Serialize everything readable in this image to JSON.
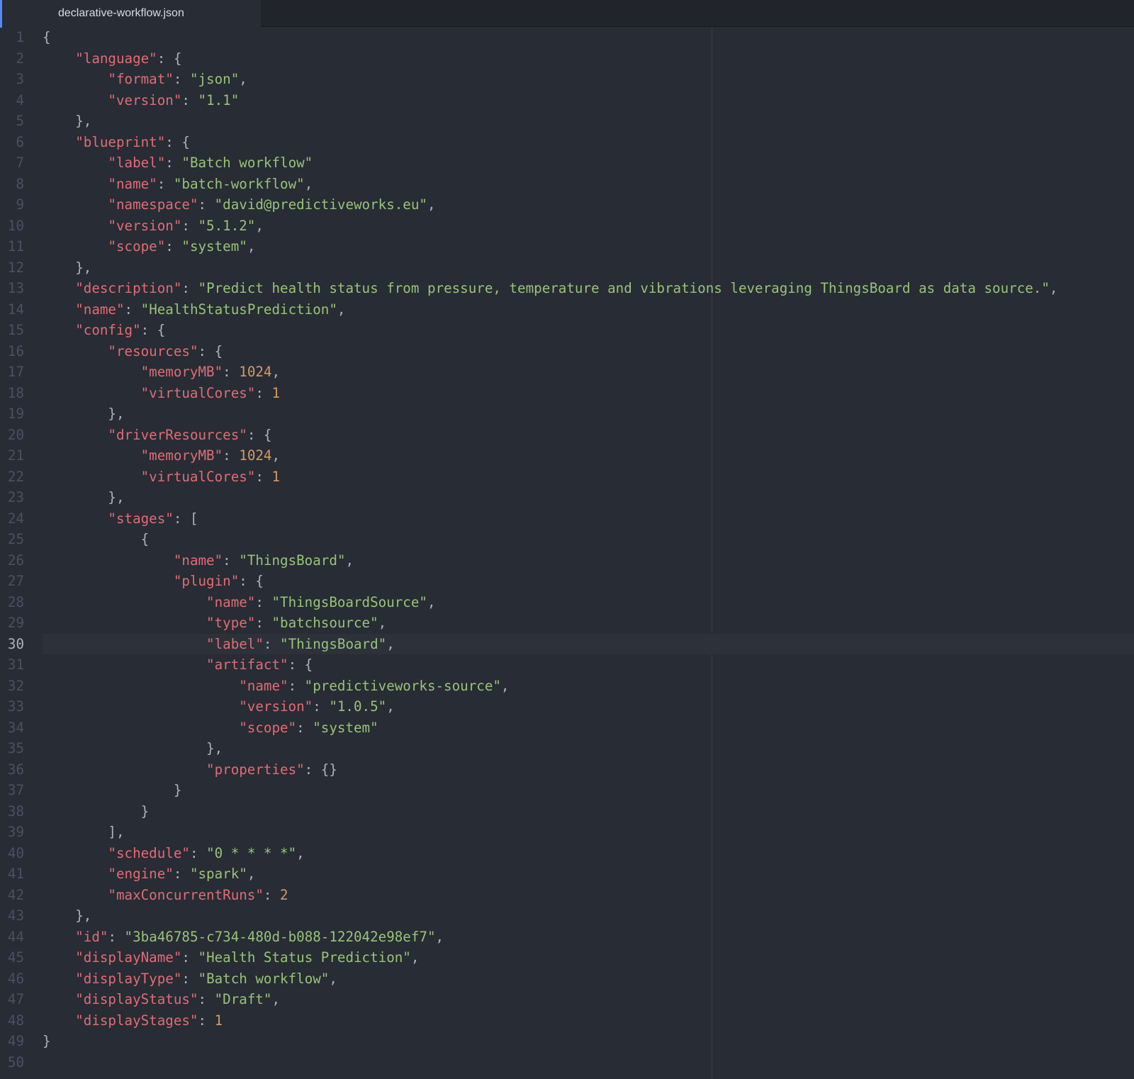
{
  "tab": {
    "title": "declarative-workflow.json"
  },
  "editor": {
    "cursor_line": 30,
    "lines": [
      [
        [
          "p",
          "{"
        ]
      ],
      [
        [
          "p",
          "    "
        ],
        [
          "k",
          "\"language\""
        ],
        [
          "p",
          ": {"
        ]
      ],
      [
        [
          "p",
          "        "
        ],
        [
          "k",
          "\"format\""
        ],
        [
          "p",
          ": "
        ],
        [
          "s",
          "\"json\""
        ],
        [
          "p",
          ","
        ]
      ],
      [
        [
          "p",
          "        "
        ],
        [
          "k",
          "\"version\""
        ],
        [
          "p",
          ": "
        ],
        [
          "s",
          "\"1.1\""
        ]
      ],
      [
        [
          "p",
          "    },"
        ]
      ],
      [
        [
          "p",
          "    "
        ],
        [
          "k",
          "\"blueprint\""
        ],
        [
          "p",
          ": {"
        ]
      ],
      [
        [
          "p",
          "        "
        ],
        [
          "k",
          "\"label\""
        ],
        [
          "p",
          ": "
        ],
        [
          "s",
          "\"Batch workflow\""
        ]
      ],
      [
        [
          "p",
          "        "
        ],
        [
          "k",
          "\"name\""
        ],
        [
          "p",
          ": "
        ],
        [
          "s",
          "\"batch-workflow\""
        ],
        [
          "p",
          ","
        ]
      ],
      [
        [
          "p",
          "        "
        ],
        [
          "k",
          "\"namespace\""
        ],
        [
          "p",
          ": "
        ],
        [
          "s",
          "\"david@predictiveworks.eu\""
        ],
        [
          "p",
          ","
        ]
      ],
      [
        [
          "p",
          "        "
        ],
        [
          "k",
          "\"version\""
        ],
        [
          "p",
          ": "
        ],
        [
          "s",
          "\"5.1.2\""
        ],
        [
          "p",
          ","
        ]
      ],
      [
        [
          "p",
          "        "
        ],
        [
          "k",
          "\"scope\""
        ],
        [
          "p",
          ": "
        ],
        [
          "s",
          "\"system\""
        ],
        [
          "p",
          ","
        ]
      ],
      [
        [
          "p",
          "    },"
        ]
      ],
      [
        [
          "p",
          "    "
        ],
        [
          "k",
          "\"description\""
        ],
        [
          "p",
          ": "
        ],
        [
          "s",
          "\"Predict health status from pressure, temperature and vibrations leveraging ThingsBoard as data source.\""
        ],
        [
          "p",
          ","
        ]
      ],
      [
        [
          "p",
          "    "
        ],
        [
          "k",
          "\"name\""
        ],
        [
          "p",
          ": "
        ],
        [
          "s",
          "\"HealthStatusPrediction\""
        ],
        [
          "p",
          ","
        ]
      ],
      [
        [
          "p",
          "    "
        ],
        [
          "k",
          "\"config\""
        ],
        [
          "p",
          ": {"
        ]
      ],
      [
        [
          "p",
          "        "
        ],
        [
          "k",
          "\"resources\""
        ],
        [
          "p",
          ": {"
        ]
      ],
      [
        [
          "p",
          "            "
        ],
        [
          "k",
          "\"memoryMB\""
        ],
        [
          "p",
          ": "
        ],
        [
          "n",
          "1024"
        ],
        [
          "p",
          ","
        ]
      ],
      [
        [
          "p",
          "            "
        ],
        [
          "k",
          "\"virtualCores\""
        ],
        [
          "p",
          ": "
        ],
        [
          "n",
          "1"
        ]
      ],
      [
        [
          "p",
          "        },"
        ]
      ],
      [
        [
          "p",
          "        "
        ],
        [
          "k",
          "\"driverResources\""
        ],
        [
          "p",
          ": {"
        ]
      ],
      [
        [
          "p",
          "            "
        ],
        [
          "k",
          "\"memoryMB\""
        ],
        [
          "p",
          ": "
        ],
        [
          "n",
          "1024"
        ],
        [
          "p",
          ","
        ]
      ],
      [
        [
          "p",
          "            "
        ],
        [
          "k",
          "\"virtualCores\""
        ],
        [
          "p",
          ": "
        ],
        [
          "n",
          "1"
        ]
      ],
      [
        [
          "p",
          "        },"
        ]
      ],
      [
        [
          "p",
          "        "
        ],
        [
          "k",
          "\"stages\""
        ],
        [
          "p",
          ": ["
        ]
      ],
      [
        [
          "p",
          "            {"
        ]
      ],
      [
        [
          "p",
          "                "
        ],
        [
          "k",
          "\"name\""
        ],
        [
          "p",
          ": "
        ],
        [
          "s",
          "\"ThingsBoard\""
        ],
        [
          "p",
          ","
        ]
      ],
      [
        [
          "p",
          "                "
        ],
        [
          "k",
          "\"plugin\""
        ],
        [
          "p",
          ": {"
        ]
      ],
      [
        [
          "p",
          "                    "
        ],
        [
          "k",
          "\"name\""
        ],
        [
          "p",
          ": "
        ],
        [
          "s",
          "\"ThingsBoardSource\""
        ],
        [
          "p",
          ","
        ]
      ],
      [
        [
          "p",
          "                    "
        ],
        [
          "k",
          "\"type\""
        ],
        [
          "p",
          ": "
        ],
        [
          "s",
          "\"batchsource\""
        ],
        [
          "p",
          ","
        ]
      ],
      [
        [
          "p",
          "                    "
        ],
        [
          "k",
          "\"label\""
        ],
        [
          "p",
          ": "
        ],
        [
          "s",
          "\"ThingsBoard\""
        ],
        [
          "p",
          ","
        ]
      ],
      [
        [
          "p",
          "                    "
        ],
        [
          "k",
          "\"artifact\""
        ],
        [
          "p",
          ": {"
        ]
      ],
      [
        [
          "p",
          "                        "
        ],
        [
          "k",
          "\"name\""
        ],
        [
          "p",
          ": "
        ],
        [
          "s",
          "\"predictiveworks-source\""
        ],
        [
          "p",
          ","
        ]
      ],
      [
        [
          "p",
          "                        "
        ],
        [
          "k",
          "\"version\""
        ],
        [
          "p",
          ": "
        ],
        [
          "s",
          "\"1.0.5\""
        ],
        [
          "p",
          ","
        ]
      ],
      [
        [
          "p",
          "                        "
        ],
        [
          "k",
          "\"scope\""
        ],
        [
          "p",
          ": "
        ],
        [
          "s",
          "\"system\""
        ]
      ],
      [
        [
          "p",
          "                    },"
        ]
      ],
      [
        [
          "p",
          "                    "
        ],
        [
          "k",
          "\"properties\""
        ],
        [
          "p",
          ": {}"
        ]
      ],
      [
        [
          "p",
          "                }"
        ]
      ],
      [
        [
          "p",
          "            }"
        ]
      ],
      [
        [
          "p",
          "        ],"
        ]
      ],
      [
        [
          "p",
          "        "
        ],
        [
          "k",
          "\"schedule\""
        ],
        [
          "p",
          ": "
        ],
        [
          "s",
          "\"0 * * * *\""
        ],
        [
          "p",
          ","
        ]
      ],
      [
        [
          "p",
          "        "
        ],
        [
          "k",
          "\"engine\""
        ],
        [
          "p",
          ": "
        ],
        [
          "s",
          "\"spark\""
        ],
        [
          "p",
          ","
        ]
      ],
      [
        [
          "p",
          "        "
        ],
        [
          "k",
          "\"maxConcurrentRuns\""
        ],
        [
          "p",
          ": "
        ],
        [
          "n",
          "2"
        ]
      ],
      [
        [
          "p",
          "    },"
        ]
      ],
      [
        [
          "p",
          "    "
        ],
        [
          "k",
          "\"id\""
        ],
        [
          "p",
          ": "
        ],
        [
          "s",
          "\"3ba46785-c734-480d-b088-122042e98ef7\""
        ],
        [
          "p",
          ","
        ]
      ],
      [
        [
          "p",
          "    "
        ],
        [
          "k",
          "\"displayName\""
        ],
        [
          "p",
          ": "
        ],
        [
          "s",
          "\"Health Status Prediction\""
        ],
        [
          "p",
          ","
        ]
      ],
      [
        [
          "p",
          "    "
        ],
        [
          "k",
          "\"displayType\""
        ],
        [
          "p",
          ": "
        ],
        [
          "s",
          "\"Batch workflow\""
        ],
        [
          "p",
          ","
        ]
      ],
      [
        [
          "p",
          "    "
        ],
        [
          "k",
          "\"displayStatus\""
        ],
        [
          "p",
          ": "
        ],
        [
          "s",
          "\"Draft\""
        ],
        [
          "p",
          ","
        ]
      ],
      [
        [
          "p",
          "    "
        ],
        [
          "k",
          "\"displayStages\""
        ],
        [
          "p",
          ": "
        ],
        [
          "n",
          "1"
        ]
      ],
      [
        [
          "p",
          "}"
        ]
      ],
      []
    ]
  }
}
